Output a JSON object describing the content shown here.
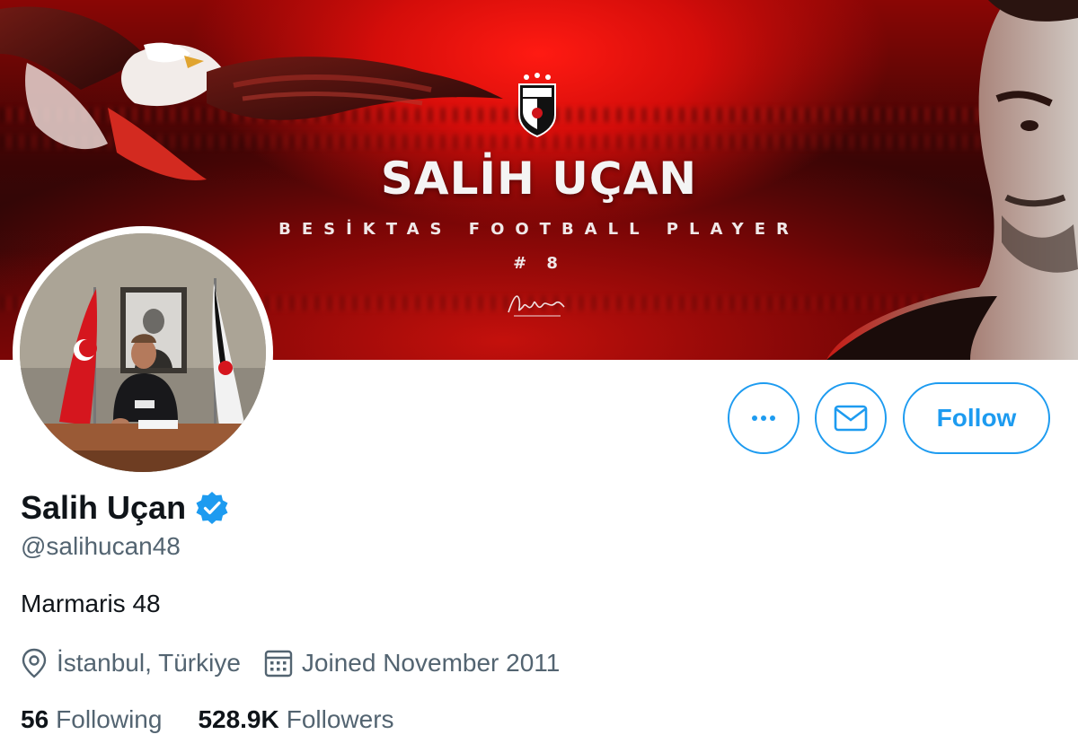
{
  "banner": {
    "title": "SALİH UÇAN",
    "subtitle": "BESİKTAS FOOTBALL PLAYER",
    "number": "# 8"
  },
  "profile": {
    "display_name": "Salih Uçan",
    "handle": "@salihucan48",
    "bio": "Marmaris 48",
    "location": "İstanbul, Türkiye",
    "joined": "Joined November 2011",
    "verified_icon": "verified-badge-icon",
    "accent_color": "#1d9bf0"
  },
  "actions": {
    "more_icon": "more-options-icon",
    "message_icon": "envelope-icon",
    "follow_label": "Follow"
  },
  "stats": {
    "following_count": "56",
    "following_label": "Following",
    "followers_count": "528.9K",
    "followers_label": "Followers"
  }
}
